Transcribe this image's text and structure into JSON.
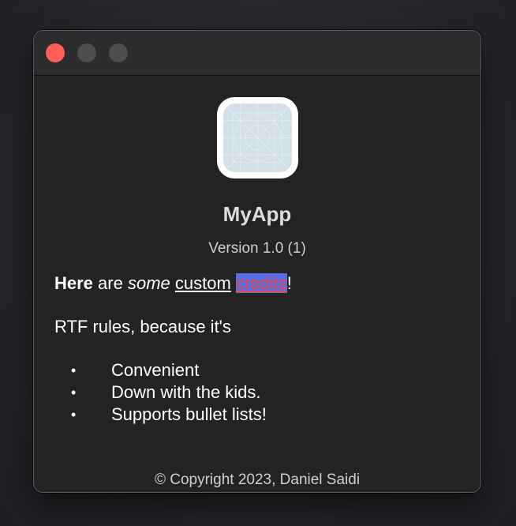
{
  "window": {
    "controls": {
      "close_icon": "close-icon",
      "minimize_icon": "minimize-icon",
      "zoom_icon": "zoom-icon"
    }
  },
  "colors": {
    "close": "#ff5f57",
    "inactive_control": "#4d4d4f",
    "highlight_bg": "#5b6ee1",
    "highlight_text": "#e5484d"
  },
  "about": {
    "app_icon": "app-placeholder-icon",
    "app_name": "MyApp",
    "version": "Version 1.0 (1)",
    "credits": {
      "line1": {
        "bold": "Here",
        "t1": " are ",
        "italic": "some",
        "t2": " ",
        "underline": "custom",
        "t3": " ",
        "highlight": "credits",
        "t4": "!"
      },
      "line2": "RTF rules, because it's",
      "bullet_char": "•",
      "bullets": [
        "Convenient",
        "Down with the kids.",
        "Supports bullet lists!"
      ]
    },
    "copyright": "© Copyright 2023, Daniel Saidi"
  }
}
